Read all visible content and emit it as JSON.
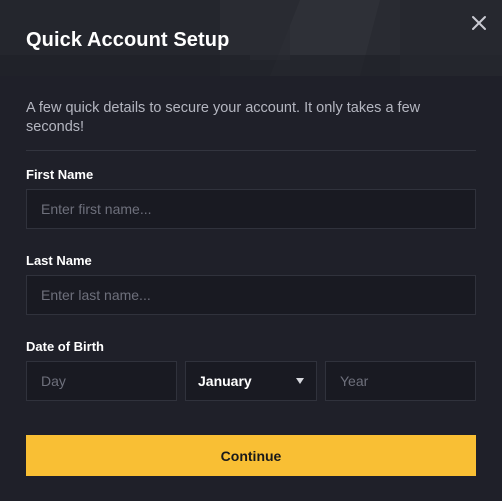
{
  "modal": {
    "title": "Quick Account Setup",
    "close_icon": "close-icon",
    "intro": "A few quick details to secure your account. It only takes a few seconds!"
  },
  "form": {
    "first_name": {
      "label": "First Name",
      "placeholder": "Enter first name...",
      "value": ""
    },
    "last_name": {
      "label": "Last Name",
      "placeholder": "Enter last name...",
      "value": ""
    },
    "dob": {
      "label": "Date of Birth",
      "day_placeholder": "Day",
      "month_selected": "January",
      "year_placeholder": "Year"
    }
  },
  "actions": {
    "continue_label": "Continue"
  },
  "colors": {
    "background": "#1f2029",
    "input_bg": "#191a22",
    "accent": "#f9bf34",
    "text": "#ffffff",
    "muted": "#b4b6c0"
  }
}
